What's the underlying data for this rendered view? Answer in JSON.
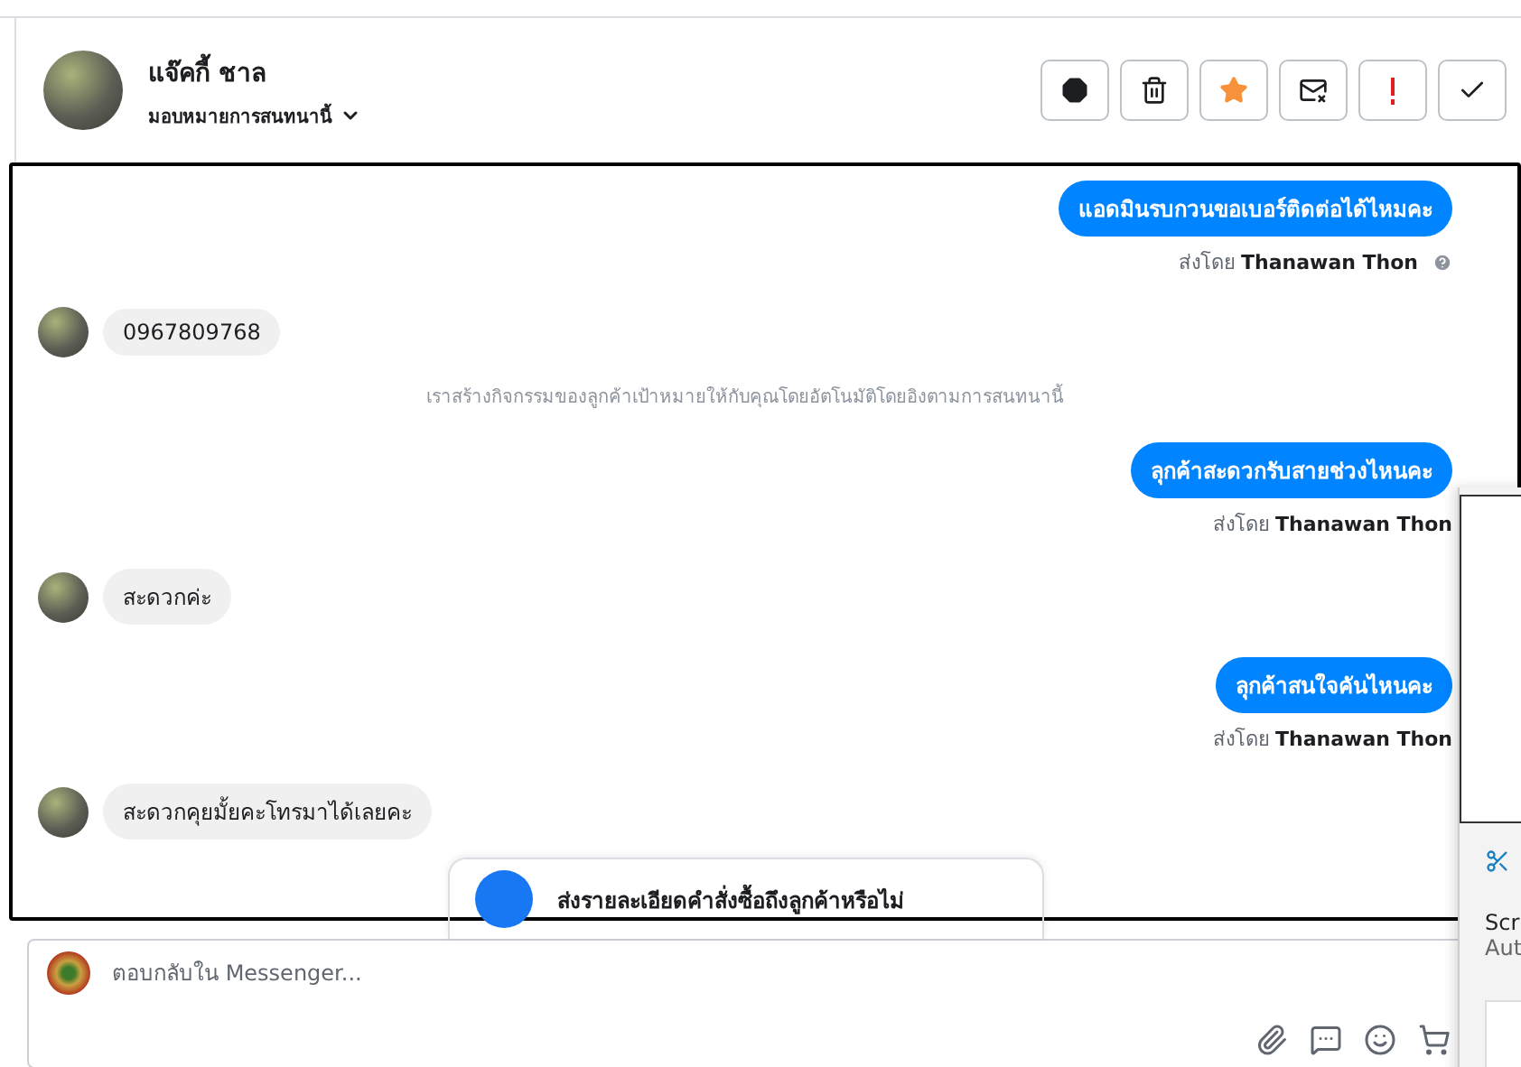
{
  "header": {
    "name": "แจ๊คกี้ ชาล",
    "assign_label": "มอบหมายการสนทนานี้",
    "starred": true
  },
  "messages": [
    {
      "kind": "outgoing",
      "text": "แอดมินรบกวนขอเบอร์ติดต่อได้ไหมคะ"
    },
    {
      "kind": "sender",
      "text": "ส่งโดย **Thanawan Thon**",
      "help_icon": true
    },
    {
      "kind": "incoming",
      "text": "0967809768"
    },
    {
      "kind": "system",
      "text": "เราสร้างกิจกรรมของลูกค้าเป้าหมายให้กับคุณโดยอัตโนมัติโดยอิงตามการสนทนานี้"
    },
    {
      "kind": "outgoing",
      "text": "ลุกค้าสะดวกรับสายช่วงไหนคะ"
    },
    {
      "kind": "sender",
      "text": "ส่งโดย **Thanawan Thon**",
      "help_icon": false
    },
    {
      "kind": "incoming",
      "text": "สะดวกค่ะ"
    },
    {
      "kind": "outgoing",
      "text": "ลุกค้าสนใจคันไหนคะ"
    },
    {
      "kind": "sender",
      "text": "ส่งโดย **Thanawan Thon**",
      "help_icon": false
    },
    {
      "kind": "incoming",
      "text": "สะดวกคุยมั้ยคะโทรมาได้เลยคะ"
    },
    {
      "kind": "card",
      "text": "ส่งรายละเอียดคำสั่งซื้อถึงลูกค้าหรือไม่"
    }
  ],
  "composer": {
    "placeholder": "ตอบกลับใน Messenger..."
  },
  "notification": {
    "title": "Scr",
    "subtitle": "Aut"
  }
}
